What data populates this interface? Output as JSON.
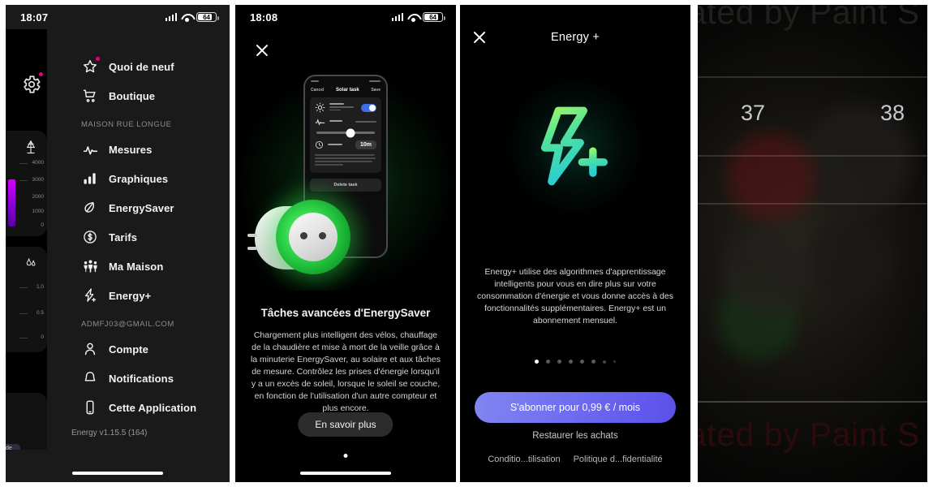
{
  "panel1": {
    "name": "energy-app-side-menu",
    "status": {
      "time": "18:07",
      "battery": "64"
    },
    "gear_icon": "gear-icon",
    "mini_cards": [
      {
        "icon": "power-pylon-icon",
        "ticks": [
          "4000",
          "3000",
          "2000",
          "1000",
          "0"
        ]
      },
      {
        "icon": "water-drop-icon",
        "ticks": [
          "1.0",
          "0.5",
          "0"
        ]
      },
      {
        "icon": "chart-card-icon",
        "pill": "de"
      }
    ],
    "menu_top": [
      {
        "label": "Quoi de neuf",
        "icon": "star-icon",
        "badge": true
      },
      {
        "label": "Boutique",
        "icon": "shopping-cart-icon",
        "badge": false
      }
    ],
    "section1_label": "MAISON RUE LONGUE",
    "menu_home": [
      {
        "label": "Mesures",
        "icon": "pulse-icon"
      },
      {
        "label": "Graphiques",
        "icon": "bar-chart-icon"
      },
      {
        "label": "EnergySaver",
        "icon": "leaf-icon"
      },
      {
        "label": "Tarifs",
        "icon": "dollar-circle-icon"
      },
      {
        "label": "Ma Maison",
        "icon": "family-icon"
      },
      {
        "label": "Energy+",
        "icon": "bolt-plus-icon"
      }
    ],
    "section2_label": "ADMFJ03@GMAIL.COM",
    "menu_account": [
      {
        "label": "Compte",
        "icon": "person-icon"
      },
      {
        "label": "Notifications",
        "icon": "bell-icon"
      },
      {
        "label": "Cette Application",
        "icon": "phone-icon"
      }
    ],
    "version": "Energy v1.15.5 (164)"
  },
  "panel2": {
    "name": "energysaver-promo-screen",
    "status": {
      "time": "18:08",
      "battery": "64"
    },
    "close_icon": "close-icon",
    "hero": {
      "phone_nav": {
        "left": "Cancel",
        "title": "Solar task",
        "right": "Save"
      },
      "chip_value": "10m",
      "delete_label": "Delete task",
      "product": "smart-plug-green"
    },
    "title": "Tâches avancées d'EnergySaver",
    "body": "Chargement plus intelligent des vélos, chauffage de la chaudière et mise à mort de la veille grâce à la minuterie EnergySaver, au solaire et aux tâches de mesure. Contrôlez les prises d'énergie lorsqu'il y a un excès de soleil, lorsque le soleil se couche, en fonction de l'utilisation d'un autre compteur et plus encore.",
    "button": "En savoir plus"
  },
  "panel3": {
    "name": "energy-plus-subscription-screen",
    "close_icon": "close-icon",
    "title": "Energy +",
    "logo_icon": "bolt-plus-logo",
    "logo_colors": {
      "from": "#8ef06a",
      "to": "#2ed0c8"
    },
    "body": "Energy+ utilise des algorithmes d'apprentissage intelligents pour vous en dire plus sur votre consommation d'énergie et vous donne accès à des fonctionnalités supplémentaires. Energy+ est un abonnement mensuel.",
    "pagination": {
      "total": 8,
      "active": 1
    },
    "cta": "S'abonner pour 0,99 € / mois",
    "cta_color": "#6f6ef0",
    "restore": "Restaurer les achats",
    "legal": [
      "Conditio...tilisation",
      "Politique d...fidentialité"
    ]
  },
  "panel4": {
    "name": "dark-blurred-photo-panel",
    "numbers": [
      "37",
      "38"
    ],
    "watermark_top": "ated by Paint S",
    "watermark_bottom": "ated by Paint S"
  }
}
